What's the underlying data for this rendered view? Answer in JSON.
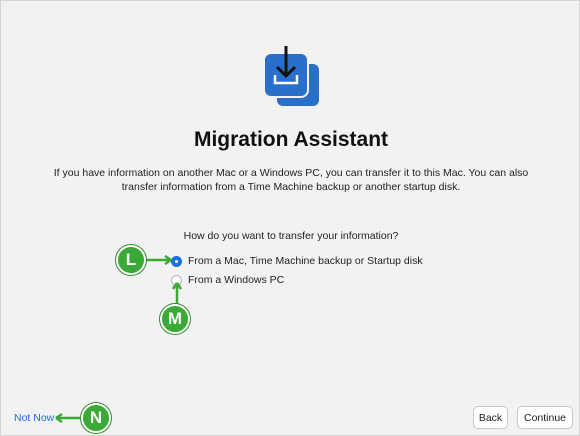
{
  "dialog": {
    "title": "Migration Assistant",
    "description_line1": "If you have information on another Mac or a Windows PC, you can transfer it to this Mac. You can also",
    "description_line2": "transfer information from a Time Machine backup or another startup disk.",
    "question": "How do you want to transfer your information?",
    "options": [
      {
        "label": "From a Mac, Time Machine backup or Startup disk",
        "selected": true
      },
      {
        "label": "From a Windows PC",
        "selected": false
      }
    ]
  },
  "footer": {
    "not_now": "Not Now",
    "back": "Back",
    "continue": "Continue"
  },
  "callouts": {
    "l": "L",
    "m": "M",
    "n": "N"
  },
  "colors": {
    "accent": "#1a6fe0",
    "icon_blue": "#2a6fc9",
    "callout_green": "#3aa935"
  },
  "icons": {
    "app": "migration-assistant-icon"
  }
}
